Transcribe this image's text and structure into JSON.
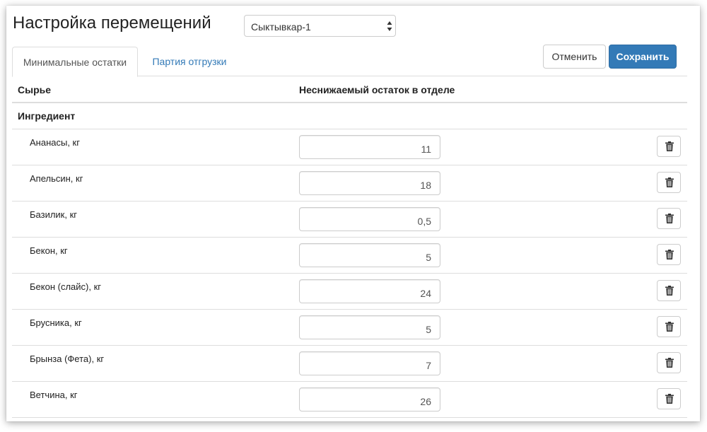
{
  "header": {
    "title": "Настройка перемещений",
    "location_select": {
      "value": "Сыктывкар-1"
    }
  },
  "tabs": [
    {
      "label": "Минимальные остатки",
      "active": true
    },
    {
      "label": "Партия отгрузки",
      "active": false
    }
  ],
  "actions": {
    "cancel_label": "Отменить",
    "save_label": "Сохранить"
  },
  "table": {
    "columns": [
      "Сырье",
      "Неснижаемый остаток в отделе"
    ],
    "group": "Ингредиент",
    "rows": [
      {
        "name": "Ананасы, кг",
        "value": "11"
      },
      {
        "name": "Апельсин, кг",
        "value": "18"
      },
      {
        "name": "Базилик, кг",
        "value": "0,5"
      },
      {
        "name": "Бекон, кг",
        "value": "5"
      },
      {
        "name": "Бекон (слайс), кг",
        "value": "24"
      },
      {
        "name": "Брусника, кг",
        "value": "5"
      },
      {
        "name": "Брынза (Фета), кг",
        "value": "7"
      },
      {
        "name": "Ветчина, кг",
        "value": "26"
      }
    ]
  },
  "icons": {
    "select_arrows": "updown-arrows-icon",
    "delete": "trash-icon"
  },
  "colors": {
    "primary": "#337ab7",
    "link": "#337ab7",
    "border": "#dddddd"
  }
}
